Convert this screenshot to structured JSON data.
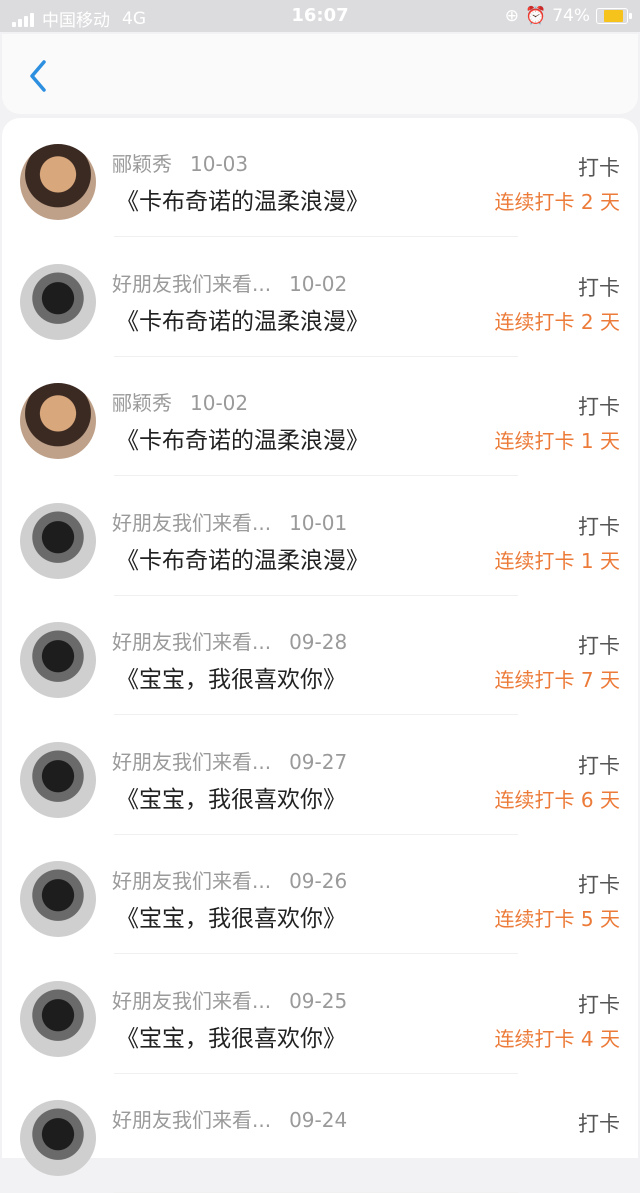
{
  "status_bar": {
    "carrier": "中国移动",
    "network": "4G",
    "time": "16:07",
    "battery": "74%",
    "battery_fraction": 0.74
  },
  "nav": {
    "back_icon": "chevron-left-icon"
  },
  "records": [
    {
      "name": "郦颖秀",
      "date": "10-03",
      "title": "《卡布奇诺的温柔浪漫》",
      "action": "打卡",
      "streak": "连续打卡 2 天",
      "avatar": "type-a"
    },
    {
      "name": "好朋友我们来看...",
      "date": "10-02",
      "title": "《卡布奇诺的温柔浪漫》",
      "action": "打卡",
      "streak": "连续打卡 2 天",
      "avatar": "type-b"
    },
    {
      "name": "郦颖秀",
      "date": "10-02",
      "title": "《卡布奇诺的温柔浪漫》",
      "action": "打卡",
      "streak": "连续打卡 1 天",
      "avatar": "type-a"
    },
    {
      "name": "好朋友我们来看...",
      "date": "10-01",
      "title": "《卡布奇诺的温柔浪漫》",
      "action": "打卡",
      "streak": "连续打卡 1 天",
      "avatar": "type-b"
    },
    {
      "name": "好朋友我们来看...",
      "date": "09-28",
      "title": "《宝宝，我很喜欢你》",
      "action": "打卡",
      "streak": "连续打卡 7 天",
      "avatar": "type-b"
    },
    {
      "name": "好朋友我们来看...",
      "date": "09-27",
      "title": "《宝宝，我很喜欢你》",
      "action": "打卡",
      "streak": "连续打卡 6 天",
      "avatar": "type-b"
    },
    {
      "name": "好朋友我们来看...",
      "date": "09-26",
      "title": "《宝宝，我很喜欢你》",
      "action": "打卡",
      "streak": "连续打卡 5 天",
      "avatar": "type-b"
    },
    {
      "name": "好朋友我们来看...",
      "date": "09-25",
      "title": "《宝宝，我很喜欢你》",
      "action": "打卡",
      "streak": "连续打卡 4 天",
      "avatar": "type-b"
    },
    {
      "name": "好朋友我们来看...",
      "date": "09-24",
      "title": "",
      "action": "打卡",
      "streak": "",
      "avatar": "type-b"
    }
  ]
}
